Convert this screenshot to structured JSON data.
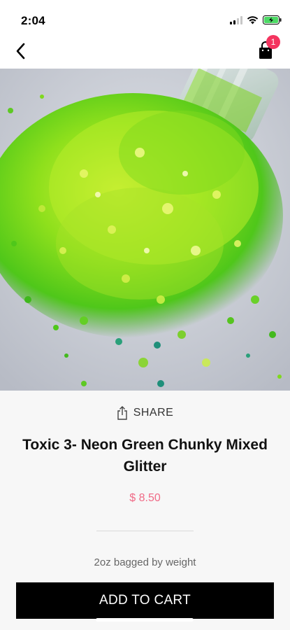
{
  "status_bar": {
    "time": "2:04"
  },
  "nav": {
    "cart_count": "1"
  },
  "product": {
    "share_label": "SHARE",
    "title": "Toxic 3- Neon Green Chunky Mixed Glitter",
    "price": "$ 8.50",
    "description": "2oz bagged by weight",
    "add_to_cart_label": "ADD TO CART"
  },
  "colors": {
    "accent_price": "#f06b87",
    "badge": "#f4345f",
    "button_bg": "#000000"
  }
}
